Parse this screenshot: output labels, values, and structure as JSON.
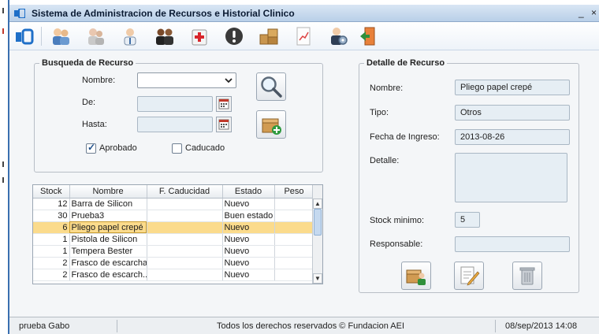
{
  "window": {
    "title": "Sistema de Administracion de Recursos e Historial Clinico",
    "minimize_glyph": "_ ×"
  },
  "toolbar": {
    "buttons": [
      {
        "icon": "home-icon"
      },
      {
        "icon": "users-icon"
      },
      {
        "icon": "patients-icon"
      },
      {
        "icon": "doctor-icon"
      },
      {
        "icon": "group-icon"
      },
      {
        "icon": "medkit-icon"
      },
      {
        "icon": "alert-icon"
      },
      {
        "icon": "boxes-icon"
      },
      {
        "icon": "report-icon"
      },
      {
        "icon": "user-settings-icon"
      },
      {
        "icon": "exit-icon"
      }
    ]
  },
  "search": {
    "legend": "Busqueda de Recurso",
    "nombre_label": "Nombre:",
    "nombre_value": "",
    "de_label": "De:",
    "de_value": "",
    "hasta_label": "Hasta:",
    "hasta_value": "",
    "aprobado_label": "Aprobado",
    "aprobado_checked": true,
    "caducado_label": "Caducado",
    "caducado_checked": false
  },
  "table": {
    "columns": [
      "Stock",
      "Nombre",
      "F. Caducidad",
      "Estado",
      "Peso"
    ],
    "rows": [
      {
        "stock": "12",
        "nombre": "Barra de Silicon",
        "caducidad": "",
        "estado": "Nuevo",
        "peso": ""
      },
      {
        "stock": "30",
        "nombre": "Prueba3",
        "caducidad": "",
        "estado": "Buen estado",
        "peso": ""
      },
      {
        "stock": "6",
        "nombre": "Pliego papel crepé",
        "caducidad": "",
        "estado": "Nuevo",
        "peso": ""
      },
      {
        "stock": "1",
        "nombre": "Pistola de Silicon",
        "caducidad": "",
        "estado": "Nuevo",
        "peso": ""
      },
      {
        "stock": "1",
        "nombre": "Tempera Bester",
        "caducidad": "",
        "estado": "Nuevo",
        "peso": ""
      },
      {
        "stock": "2",
        "nombre": "Frasco de escarcha",
        "caducidad": "",
        "estado": "Nuevo",
        "peso": ""
      },
      {
        "stock": "2",
        "nombre": "Frasco de escarch...",
        "caducidad": "",
        "estado": "Nuevo",
        "peso": ""
      }
    ],
    "selected_index": 2
  },
  "detail": {
    "legend": "Detalle de Recurso",
    "nombre_label": "Nombre:",
    "nombre_value": "Pliego papel crepé",
    "tipo_label": "Tipo:",
    "tipo_value": "Otros",
    "fecha_label": "Fecha de Ingreso:",
    "fecha_value": "2013-08-26",
    "detalle_label": "Detalle:",
    "detalle_value": "",
    "stock_label": "Stock minimo:",
    "stock_value": "5",
    "responsable_label": "Responsable:",
    "responsable_value": ""
  },
  "status": {
    "user": "prueba Gabo",
    "copyright": "Todos los derechos reservados © Fundacion AEI",
    "datetime": "08/sep/2013 14:08"
  },
  "colors": {
    "selected_row": "#fbdb8c",
    "field_bg": "#e6eef4",
    "accent": "#3a6fb0"
  }
}
